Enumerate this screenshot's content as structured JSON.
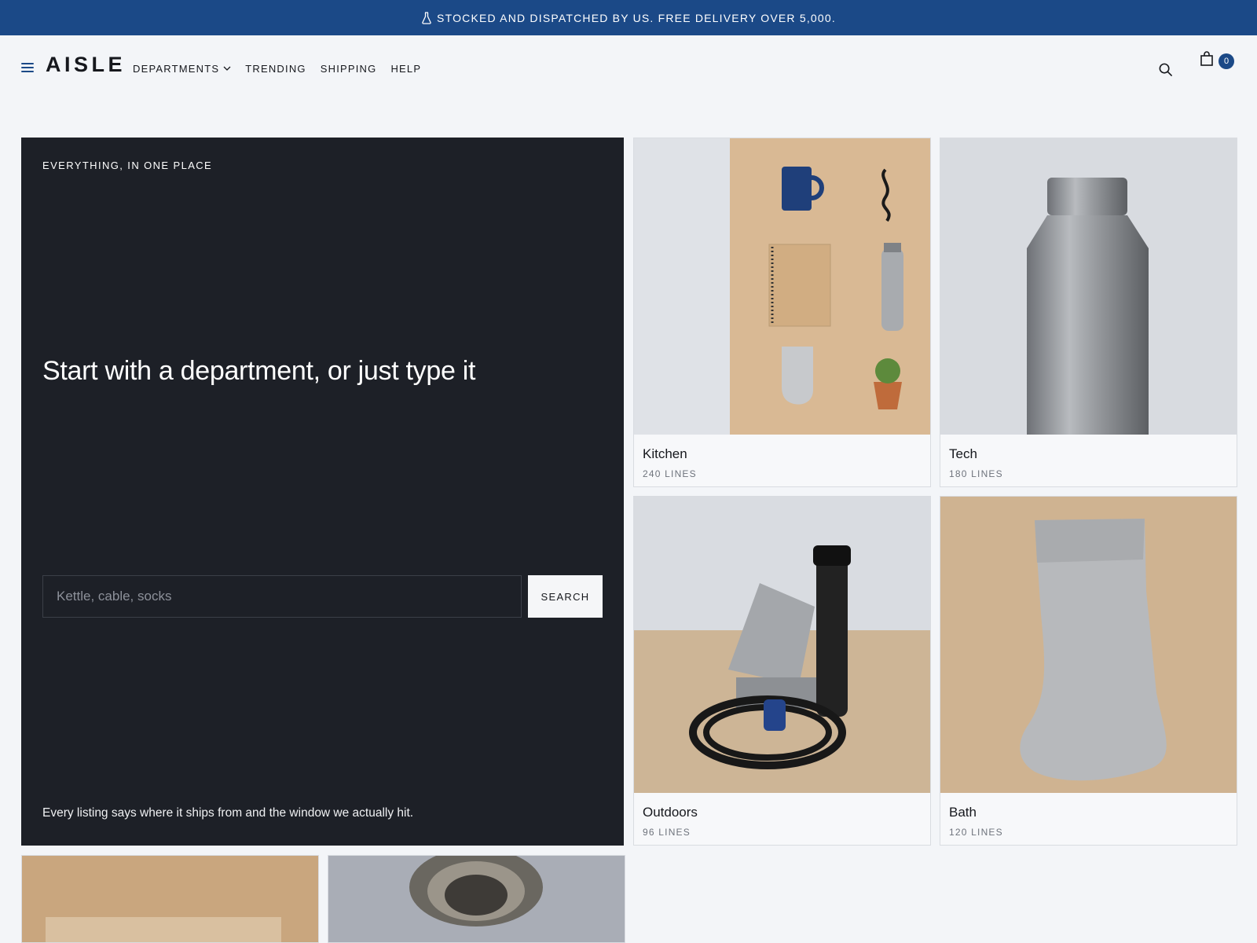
{
  "announcement": {
    "text": "STOCKED AND DISPATCHED BY US. FREE DELIVERY OVER 5,000.",
    "icon": "flask-icon"
  },
  "header": {
    "logo": "AISLE",
    "nav": [
      {
        "label": "DEPARTMENTS",
        "has_dropdown": true
      },
      {
        "label": "TRENDING"
      },
      {
        "label": "SHIPPING"
      },
      {
        "label": "HELP"
      }
    ],
    "cart_count": "0"
  },
  "hero": {
    "eyebrow": "EVERYTHING, IN ONE PLACE",
    "title": "Start with a department, or just type it",
    "search_placeholder": "Kettle, cable, socks",
    "search_value": "",
    "search_button": "SEARCH",
    "footnote": "Every listing says where it ships from and the window we actually hit."
  },
  "departments": [
    {
      "name": "Kitchen",
      "meta": "240 LINES",
      "image": "flat-lay-products"
    },
    {
      "name": "Tech",
      "meta": "180 LINES",
      "image": "steel-bottle"
    },
    {
      "name": "Outdoors",
      "meta": "96 LINES",
      "image": "flashlight-stand-cable"
    },
    {
      "name": "Bath",
      "meta": "120 LINES",
      "image": "grey-sock"
    }
  ],
  "colors": {
    "accent": "#1b4987",
    "hero_bg": "#1d2027",
    "page_bg": "#f3f5f8"
  }
}
